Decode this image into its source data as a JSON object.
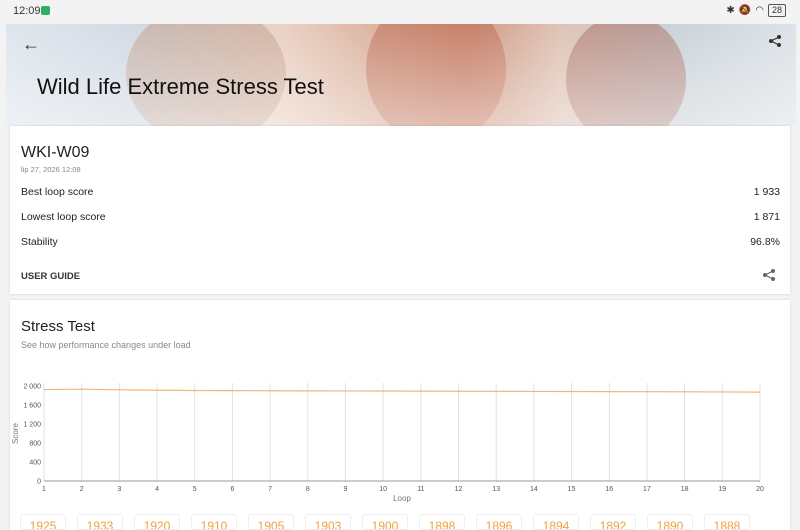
{
  "status": {
    "time": "12:09",
    "battery": "28"
  },
  "hero": {
    "title": "Wild Life Extreme Stress Test"
  },
  "result": {
    "device": "WKI-W09",
    "date": "lip 27, 2026 12:08",
    "rows": [
      {
        "label": "Best loop score",
        "value": "1 933"
      },
      {
        "label": "Lowest loop score",
        "value": "1 871"
      },
      {
        "label": "Stability",
        "value": "96.8%"
      }
    ],
    "user_guide": "USER GUIDE"
  },
  "stress": {
    "title": "Stress Test",
    "subtitle": "See how performance changes under load"
  },
  "chart_data": {
    "type": "line",
    "xlabel": "Loop",
    "ylabel": "Score",
    "ylim": [
      0,
      2000
    ],
    "yticks": [
      "0",
      "400",
      "800",
      "1 200",
      "1 600",
      "2 000"
    ],
    "x": [
      1,
      2,
      3,
      4,
      5,
      6,
      7,
      8,
      9,
      10,
      11,
      12,
      13,
      14,
      15,
      16,
      17,
      18,
      19,
      20
    ],
    "series": [
      {
        "values": [
          1925,
          1933,
          1920,
          1910,
          1905,
          1903,
          1900,
          1898,
          1896,
          1894,
          1892,
          1890,
          1888,
          1886,
          1884,
          1882,
          1880,
          1878,
          1875,
          1871
        ],
        "color": "#f3b57a"
      }
    ],
    "grid": true
  },
  "pills": [
    "1925",
    "1933",
    "1920",
    "1910",
    "1905",
    "1903",
    "1900",
    "1898",
    "1896",
    "1894",
    "1892",
    "1890",
    "1888"
  ]
}
